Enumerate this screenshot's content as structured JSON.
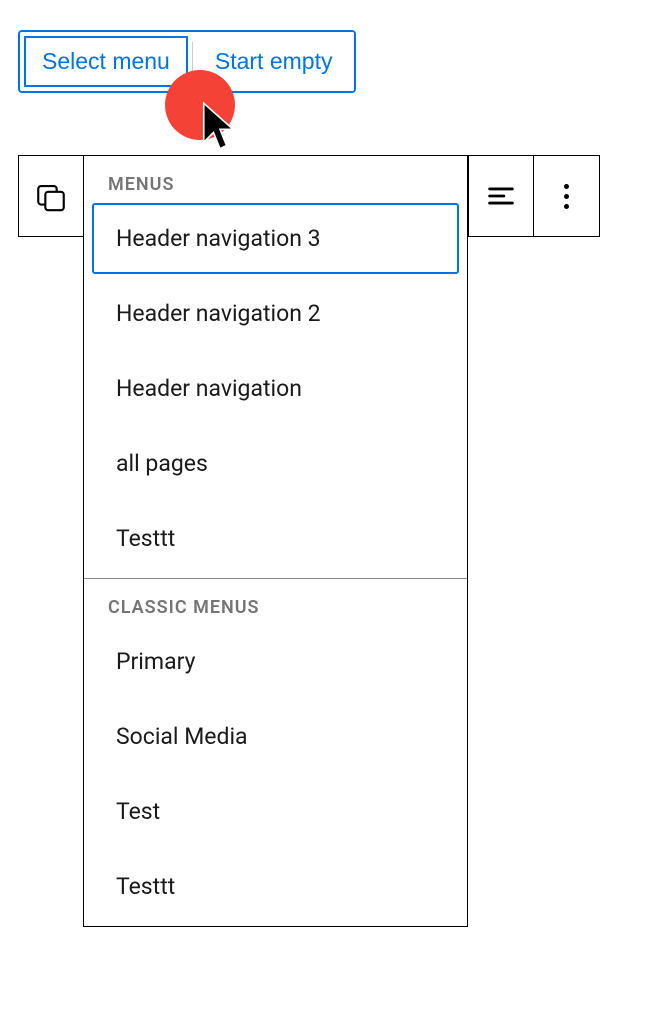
{
  "buttons": {
    "select_menu": "Select menu",
    "start_empty": "Start empty"
  },
  "dropdown": {
    "sections": [
      {
        "header": "MENUS",
        "items": [
          "Header navigation 3",
          "Header navigation 2",
          "Header navigation",
          "all pages",
          "Testtt"
        ]
      },
      {
        "header": "CLASSIC MENUS",
        "items": [
          "Primary",
          "Social Media",
          "Test",
          "Testtt"
        ]
      }
    ]
  },
  "colors": {
    "accent": "#0073e6",
    "highlight": "#f44336"
  }
}
